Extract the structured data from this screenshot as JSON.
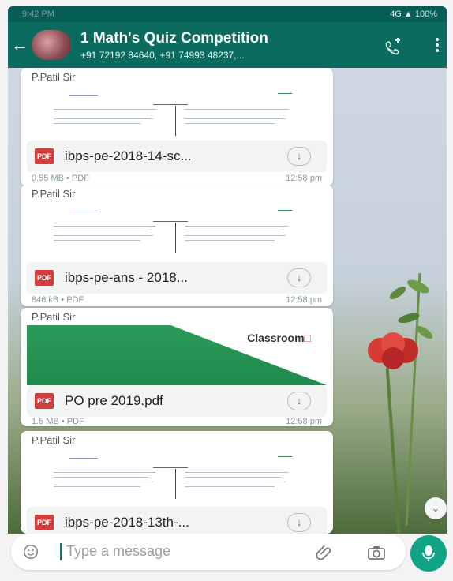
{
  "status_bar": {
    "time": "9:42 PM",
    "right": "4G ▲ 100%"
  },
  "header": {
    "title": "1 Math's Quiz Competition",
    "subtitle": "+91 72192 84640, +91 74993 48237,..."
  },
  "messages": [
    {
      "sender": "P.Patil Sir",
      "file_name": "ibps-pe-2018-14-sc...",
      "meta": "0.55 MB • PDF",
      "time": "12:58 pm",
      "preview_type": "document"
    },
    {
      "sender": "P.Patil Sir",
      "file_name": "ibps-pe-ans - 2018...",
      "meta": "846 kB • PDF",
      "time": "12:58 pm",
      "preview_type": "document"
    },
    {
      "sender": "P.Patil Sir",
      "file_name": "PO pre 2019.pdf",
      "meta": "1.5 MB • PDF",
      "time": "12:58 pm",
      "preview_type": "green",
      "preview_brand_prefix": "Classroom",
      "preview_brand_suffix": "□"
    },
    {
      "sender": "P.Patil Sir",
      "file_name": "ibps-pe-2018-13th-...",
      "meta": "",
      "time": "",
      "preview_type": "document"
    }
  ],
  "composer": {
    "placeholder": "Type a message"
  },
  "icons": {
    "back": "back-arrow-icon",
    "call": "add-call-icon",
    "menu": "menu-icon",
    "pdf": "pdf-icon",
    "download": "download-icon",
    "emoji": "emoji-icon",
    "attach": "attach-icon",
    "camera": "camera-icon",
    "mic": "mic-icon",
    "scroll": "scroll-down-icon"
  },
  "colors": {
    "header": "#0b6b5e",
    "accent": "#11a386",
    "pdf": "#d43d3d"
  }
}
